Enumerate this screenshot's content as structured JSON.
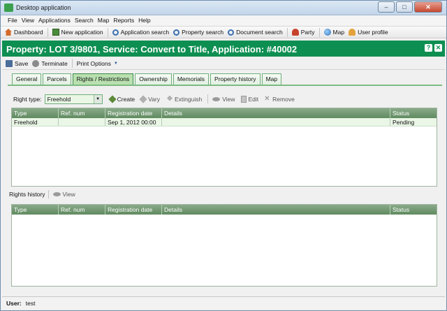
{
  "window": {
    "title": "Desktop application",
    "buttons": {
      "minimize": "–",
      "maximize": "□",
      "close": "✕"
    }
  },
  "menu": [
    "File",
    "View",
    "Applications",
    "Search",
    "Map",
    "Reports",
    "Help"
  ],
  "toolbar": {
    "dashboard": "Dashboard",
    "new_application": "New application",
    "application_search": "Application search",
    "property_search": "Property search",
    "document_search": "Document search",
    "party": "Party",
    "map": "Map",
    "user_profile": "User profile"
  },
  "header": {
    "title": "Property: LOT 3/9801, Service: Convert to Title,  Application: #40002",
    "help_icon": "?",
    "close_icon": "✕"
  },
  "actions": {
    "save": "Save",
    "terminate": "Terminate",
    "print_options": "Print Options"
  },
  "tabs": [
    "General",
    "Parcels",
    "Rights / Restrictions",
    "Ownership",
    "Memorials",
    "Property history",
    "Map"
  ],
  "active_tab": "Rights / Restrictions",
  "rights": {
    "right_type_label": "Right type:",
    "right_type_value": "Freehold",
    "create": "Create",
    "vary": "Vary",
    "extinguish": "Extinguish",
    "view": "View",
    "edit": "Edit",
    "remove": "Remove",
    "columns": [
      "Type",
      "Ref. num",
      "Registration date",
      "Details",
      "Status"
    ],
    "rows": [
      {
        "type": "Freehold",
        "ref": "",
        "date": "Sep 1, 2012 00:00",
        "details": "",
        "status": "Pending"
      }
    ]
  },
  "history": {
    "label": "Rights history",
    "view": "View",
    "columns": [
      "Type",
      "Ref. num",
      "Registration date",
      "Details",
      "Status"
    ]
  },
  "status": {
    "user_label": "User:",
    "user_value": "test"
  },
  "colors": {
    "header_bg": "#0e8f52",
    "tab_active": "#b9e0b0",
    "grid_head": "#6f956f"
  }
}
